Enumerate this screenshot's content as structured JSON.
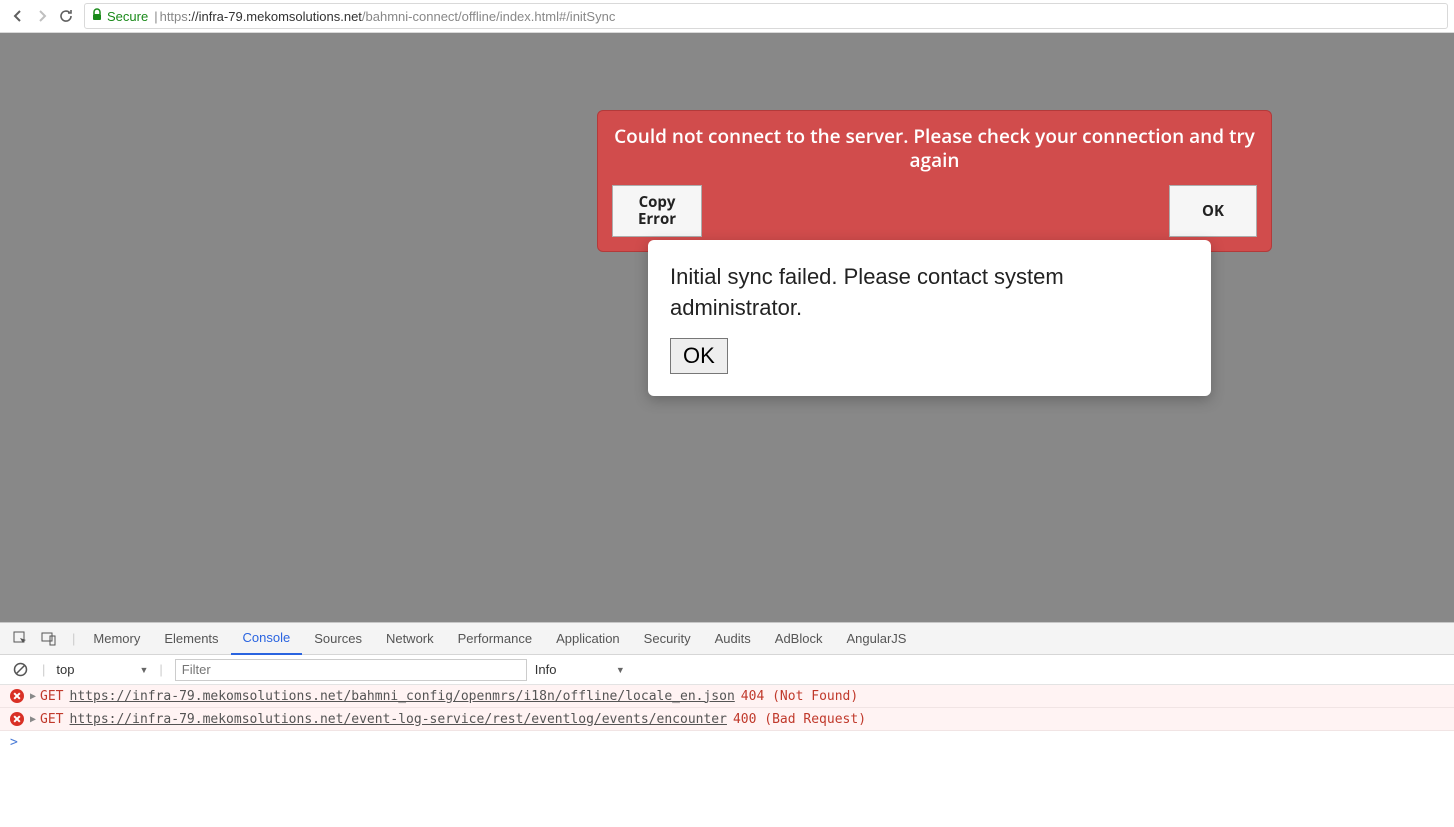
{
  "browser": {
    "secure_label": "Secure",
    "url_scheme": "https",
    "url_host": "://infra-79.mekomsolutions.net",
    "url_path": "/bahmni-connect/offline/index.html#/initSync"
  },
  "error_banner": {
    "message": "Could not connect to the server. Please check your connection and try again",
    "copy_label": "Copy Error",
    "ok_label": "OK"
  },
  "sync_dialog": {
    "message": "Initial sync failed. Please contact system administrator.",
    "ok_label": "OK"
  },
  "devtools": {
    "tabs": [
      "Memory",
      "Elements",
      "Console",
      "Sources",
      "Network",
      "Performance",
      "Application",
      "Security",
      "Audits",
      "AdBlock",
      "AngularJS"
    ],
    "active_tab": "Console",
    "context": "top",
    "filter_placeholder": "Filter",
    "level": "Info",
    "rows": [
      {
        "method": "GET",
        "url": "https://infra-79.mekomsolutions.net/bahmni_config/openmrs/i18n/offline/locale_en.json",
        "status": "404 (Not Found)"
      },
      {
        "method": "GET",
        "url": "https://infra-79.mekomsolutions.net/event-log-service/rest/eventlog/events/encounter",
        "status": "400 (Bad Request)"
      }
    ],
    "prompt": ">"
  }
}
